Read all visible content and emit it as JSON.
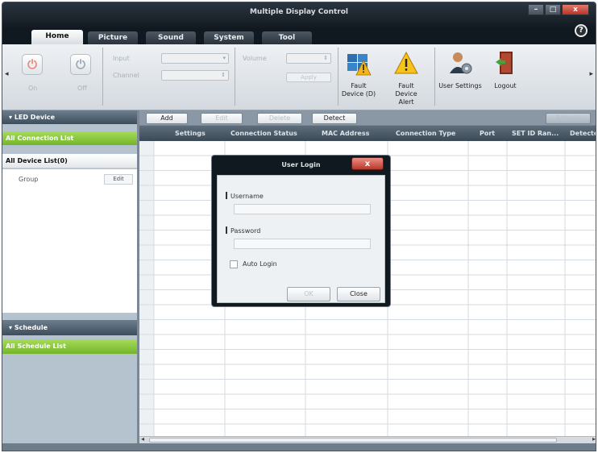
{
  "window": {
    "title": "Multiple Display Control",
    "min": "–",
    "max": "□",
    "close": "x",
    "help": "?"
  },
  "tabs": [
    {
      "label": "Home",
      "active": true
    },
    {
      "label": "Picture"
    },
    {
      "label": "Sound"
    },
    {
      "label": "System"
    },
    {
      "label": "Tool"
    }
  ],
  "ribbon": {
    "power_on_label": "On",
    "power_off_label": "Off",
    "input_label": "Input",
    "channel_label": "Channel",
    "volume_label": "Volume",
    "apply_label": "Apply",
    "fault_device_d": "Fault Device (D)",
    "fault_device_alert": "Fault Device Alert",
    "user_settings": "User Settings",
    "logout": "Logout"
  },
  "left": {
    "led_device": "LED Device",
    "all_connection_list": "All Connection List",
    "all_device_list": "All Device List(0)",
    "group": "Group",
    "edit": "Edit",
    "schedule": "Schedule",
    "all_schedule_list": "All Schedule List"
  },
  "toolbar": {
    "add": "Add",
    "edit": "Edit",
    "delete": "Delete",
    "detect": "Detect",
    "refresh": "Refresh"
  },
  "grid": {
    "columns": [
      "Settings",
      "Connection Status",
      "MAC Address",
      "Connection Type",
      "Port",
      "SET ID Ran...",
      "Detected"
    ]
  },
  "dialog": {
    "title": "User Login",
    "close_icon": "x",
    "username_label": "Username",
    "username_value": "",
    "password_label": "Password",
    "password_value": "",
    "auto_login": "Auto Login",
    "ok": "OK",
    "close": "Close"
  },
  "colors": {
    "green": "#8bc93f",
    "titlebar": "#1b232b",
    "panel": "#b5c3cf"
  }
}
